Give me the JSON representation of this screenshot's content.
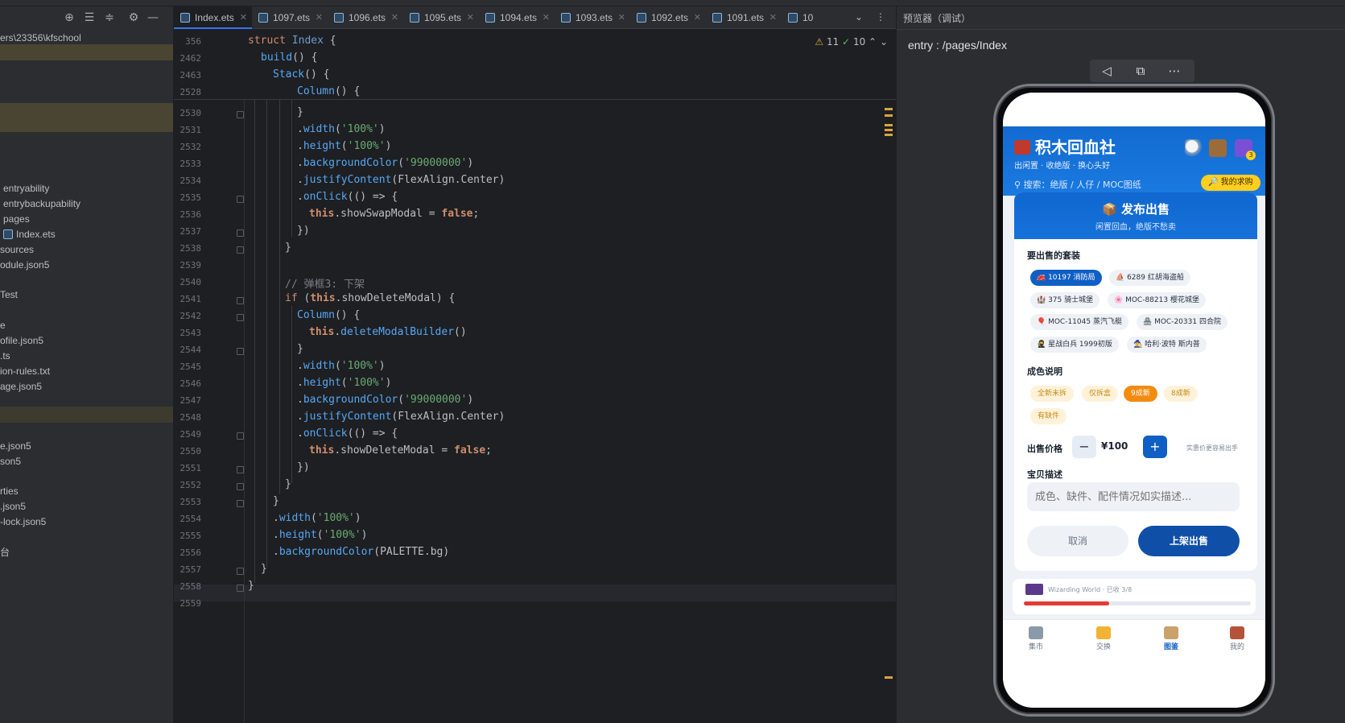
{
  "project_tree": {
    "items": [
      "ers\\23356\\kfschool",
      "",
      "",
      "",
      "entryability",
      "entrybackupability",
      "pages",
      "Index.ets",
      "sources",
      "odule.json5",
      "Test",
      "e",
      "ofile.json5",
      ".ts",
      "ion-rules.txt",
      "age.json5",
      "",
      "e.json5",
      "son5",
      "rties",
      ".json5",
      "-lock.json5",
      "台"
    ]
  },
  "editor": {
    "tabs": [
      {
        "label": "Index.ets",
        "active": true
      },
      {
        "label": "1097.ets"
      },
      {
        "label": "1096.ets"
      },
      {
        "label": "1095.ets"
      },
      {
        "label": "1094.ets"
      },
      {
        "label": "1093.ets"
      },
      {
        "label": "1092.ets"
      },
      {
        "label": "1091.ets"
      },
      {
        "label": "10"
      }
    ],
    "inspections": {
      "warnings": "11",
      "ok": "10"
    },
    "sticky_numbers": [
      "356",
      "2462",
      "2463",
      "2528"
    ],
    "line_numbers": [
      "2530",
      "2531",
      "2532",
      "2533",
      "2534",
      "2535",
      "2536",
      "2537",
      "2538",
      "2539",
      "2540",
      "2541",
      "2542",
      "2543",
      "2544",
      "2545",
      "2546",
      "2547",
      "2548",
      "2549",
      "2550",
      "2551",
      "2552",
      "2553",
      "2554",
      "2555",
      "2556",
      "2557",
      "2558",
      "2559"
    ],
    "code_strings": {
      "struct": "struct",
      "index": "Index",
      "build": "build",
      "stack": "Stack",
      "column": "Column",
      "width": "width",
      "height": "height",
      "backgroundColor": "backgroundColor",
      "justifyContent": "justifyContent",
      "onClick": "onClick",
      "this": "this",
      "showSwapModal": "showSwapModal",
      "false": "false",
      "if": "if",
      "showDeleteModal": "showDeleteModal",
      "deleteModalBuilder": "deleteModalBuilder",
      "pct100": "'100%'",
      "color999": "'99000000'",
      "flexAlign": "FlexAlign",
      "center": "Center",
      "palette": "PALETTE",
      "bg": "bg",
      "comment3": "// 弹框3: 下架"
    }
  },
  "preview": {
    "title": "预览器（调试）",
    "route": "entry : /pages/Index",
    "app": {
      "brand": "积木回血社",
      "slogan": "出闲置 · 收绝版 · 换心头好",
      "search_hint": "搜索：绝版 / 人仔 / MOC图纸",
      "wish_button": "🔎 我的求购",
      "cart_badge": "3",
      "modal": {
        "title": "📦 发布出售",
        "subtitle": "闲置回血，绝版不愁卖",
        "sets_label": "要出售的套装",
        "sets": [
          {
            "label": "🚒 10197 消防局",
            "selected": true
          },
          {
            "label": "⛵ 6289 红胡海盗船"
          },
          {
            "label": "🏰 375 骑士城堡"
          },
          {
            "label": "🌸 MOC-88213 樱花城堡"
          },
          {
            "label": "🎈 MOC-11045 蒸汽飞艇"
          },
          {
            "label": "🏯 MOC-20331 四合院"
          },
          {
            "label": "🥷 星战白兵 1999初版"
          },
          {
            "label": "🧙 哈利·波特 斯内普"
          }
        ],
        "condition_label": "成色说明",
        "conditions": [
          {
            "label": "全新未拆"
          },
          {
            "label": "仅拆盒"
          },
          {
            "label": "9成新",
            "selected": true
          },
          {
            "label": "8成新"
          },
          {
            "label": "有缺件"
          }
        ],
        "price_label": "出售价格",
        "minus": "−",
        "plus": "+",
        "price": "¥100",
        "price_hint": "实惠价更容易出手",
        "desc_label": "宝贝描述",
        "desc_placeholder": "成色、缺件、配件情况如实描述...",
        "cancel": "取消",
        "submit": "上架出售"
      },
      "bg_card_text": "Wizarding World · 已收 3/8",
      "progress": 0.375,
      "tabs": [
        {
          "label": "集市"
        },
        {
          "label": "交换"
        },
        {
          "label": "图鉴",
          "active": true
        },
        {
          "label": "我的"
        }
      ]
    }
  },
  "colors": {
    "editor_bg": "#1e1f22",
    "panel_bg": "#2b2d30",
    "app_primary": "#0f5fc4",
    "accent_orange": "#f28c11",
    "wish_yellow": "#ffcf1f"
  }
}
